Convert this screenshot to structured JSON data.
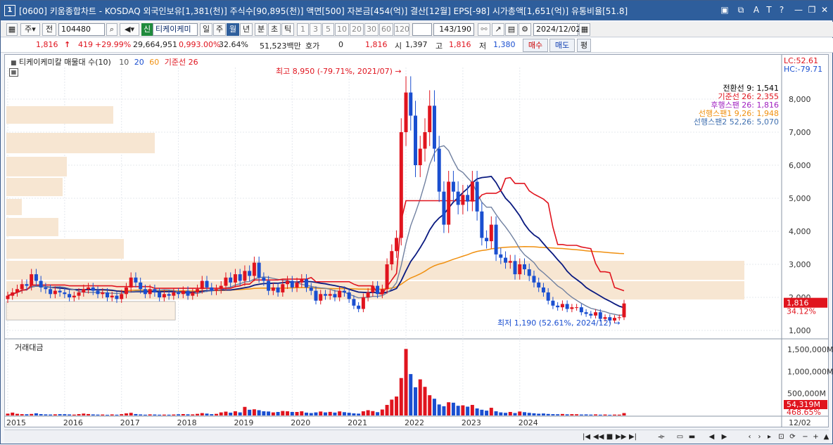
{
  "window": {
    "number": "1",
    "title": "[0600] 키움종합차트 - KOSDAQ 외국인보유[1,381(천)] 주식수[90,895(천)] 액면[500] 자본금[454(억)] 결산[12월] EPS[-98] 시가총액[1,651(억)] 유통비율[51.8]",
    "title_icons": [
      "layout-icon",
      "copy-icon",
      "text-size-icon",
      "translate-icon",
      "help-icon",
      "minimize-icon",
      "restore-icon",
      "close-icon"
    ]
  },
  "toolbar": {
    "market": "주",
    "type": "전",
    "code": "104480",
    "badge": "신",
    "name": "티케이케미",
    "periods": [
      "일",
      "주",
      "월",
      "년",
      "분",
      "초",
      "틱"
    ],
    "selected_period": "월",
    "multipliers": [
      "1",
      "3",
      "5",
      "10",
      "20",
      "30",
      "60",
      "120"
    ],
    "count": "143/190",
    "date": "2024/12/02"
  },
  "quote": {
    "price": "1,816",
    "arrow": "↑",
    "change": "419",
    "change_pct": "+29.99%",
    "volume": "29,664,951",
    "vol_ratio": "0,993.00%",
    "turnover": "32.64%",
    "amount": "51,523백만",
    "hoga_label": "호가",
    "hoga_val": "0",
    "hoga_price": "1,816",
    "open_label": "시",
    "open": "1,397",
    "high_label": "고",
    "high": "1,816",
    "low_label": "저",
    "low": "1,380",
    "buy": "매수",
    "sell": "매도",
    "eval": "평"
  },
  "legend": {
    "title": "티케이케미칼 매물대 수(10)",
    "ma10": "10",
    "ma20": "20",
    "ma60": "60",
    "base": "기준선 26",
    "ichimoku": [
      {
        "text": "전환선 9: 1,541",
        "color": "#000000"
      },
      {
        "text": "기준선 26: 2,355",
        "color": "#e0141e"
      },
      {
        "text": "후행스팬 26: 1,816",
        "color": "#a020c0"
      },
      {
        "text": "선행스팬1 9,26: 1,948",
        "color": "#f09010"
      },
      {
        "text": "선행스팬2 52,26: 5,070",
        "color": "#4070b0"
      }
    ],
    "lc": "LC:52.61",
    "hc": "HC:-79.71"
  },
  "annotations": {
    "high": "최고 8,950 (-79.71%, 2021/07) →",
    "low": "최저 1,190 (52.61%, 2024/12) →",
    "price_tag": "1,816",
    "price_pct": "34.12%",
    "vol_tag": "54,319M",
    "vol_pct": "468.65%"
  },
  "volume_legend": "거래대금",
  "price_axis": [
    "8,000",
    "7,000",
    "6,000",
    "5,000",
    "4,000",
    "3,000",
    "2,000",
    "1,000"
  ],
  "volume_axis": [
    "1,500,000M",
    "1,000,000M",
    "500,000M"
  ],
  "x_axis": [
    "2015",
    "2016",
    "2017",
    "2018",
    "2019",
    "2020",
    "2021",
    "2022",
    "2023",
    "2024"
  ],
  "x_axis_end": "12/02",
  "colors": {
    "up": "#e0141e",
    "down": "#1a4fd0",
    "volume_profile": "#f7e6d2",
    "accent": "#2e5e9c"
  },
  "chart_data": {
    "type": "candlestick",
    "period": "monthly",
    "ylim": [
      1000,
      9000
    ],
    "high": 8950,
    "high_date": "2021/07",
    "low": 1190,
    "low_date": "2024/12",
    "last_close": 1816,
    "closes": [
      2050,
      2150,
      2250,
      2400,
      2350,
      2700,
      2500,
      2300,
      2250,
      2100,
      2200,
      2150,
      2100,
      2000,
      2050,
      2150,
      2250,
      2300,
      2200,
      2100,
      2150,
      2000,
      2050,
      1950,
      2100,
      2300,
      2600,
      2450,
      2250,
      2100,
      2250,
      2150,
      2000,
      2100,
      2050,
      2150,
      2100,
      2200,
      2050,
      2150,
      2250,
      2500,
      2300,
      2200,
      2250,
      2350,
      2600,
      2450,
      2700,
      2500,
      2800,
      2650,
      3050,
      2600,
      2500,
      2200,
      2300,
      2150,
      2400,
      2500,
      2300,
      2450,
      2550,
      2300,
      2200,
      1900,
      2100,
      2050,
      2100,
      2000,
      2200,
      2150,
      1950,
      1750,
      1650,
      2000,
      2150,
      2350,
      2100,
      2250,
      3000,
      3400,
      3800,
      7000,
      8200,
      7500,
      6000,
      6500,
      7000,
      7800,
      6500,
      5200,
      4200,
      5500,
      5200,
      4800,
      5100,
      4900,
      5500,
      4600,
      3800,
      3700,
      4200,
      3300,
      3200,
      3050,
      3100,
      2700,
      3000,
      2850,
      2650,
      2450,
      2300,
      2150,
      1900,
      1750,
      1700,
      1800,
      1650,
      1700,
      1700,
      1550,
      1500,
      1450,
      1550,
      1350,
      1400,
      1300,
      1380,
      1397,
      1816
    ],
    "volume_millions": [
      42000,
      65000,
      38000,
      30000,
      28000,
      35000,
      50000,
      31000,
      25000,
      22000,
      26000,
      30000,
      29000,
      24000,
      20000,
      31000,
      43000,
      33000,
      24000,
      20000,
      22000,
      16000,
      24000,
      18000,
      30000,
      48000,
      60000,
      33000,
      24000,
      18000,
      25000,
      22000,
      18000,
      20000,
      18000,
      22000,
      27000,
      32000,
      26000,
      25000,
      37000,
      54000,
      43000,
      30000,
      37000,
      70000,
      87000,
      64000,
      95000,
      70000,
      195000,
      130000,
      140000,
      120000,
      95000,
      90000,
      70000,
      80000,
      102000,
      95000,
      80000,
      80000,
      95000,
      65000,
      55000,
      70000,
      90000,
      70000,
      82000,
      66000,
      93000,
      75000,
      62000,
      48000,
      42000,
      95000,
      120000,
      100000,
      75000,
      135000,
      240000,
      360000,
      430000,
      850000,
      1510000,
      940000,
      640000,
      820000,
      650000,
      460000,
      380000,
      250000,
      210000,
      300000,
      290000,
      220000,
      230000,
      200000,
      240000,
      160000,
      130000,
      110000,
      175000,
      95000,
      70000,
      60000,
      80000,
      55000,
      90000,
      75000,
      60000,
      50000,
      40000,
      45000,
      35000,
      30000,
      28000,
      34000,
      26000,
      30000,
      28000,
      22000,
      24000,
      20000,
      25000,
      18000,
      22000,
      15000,
      20000,
      19000,
      54319
    ]
  }
}
